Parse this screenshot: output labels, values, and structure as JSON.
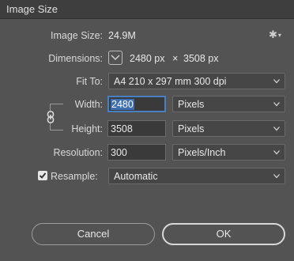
{
  "window": {
    "title": "Image Size"
  },
  "image_size": {
    "label": "Image Size:",
    "value": "24.9M"
  },
  "dimensions": {
    "label": "Dimensions:",
    "width": "2480 px",
    "times": "×",
    "height": "3508 px"
  },
  "fit_to": {
    "label": "Fit To:",
    "selected": "A4 210 x 297 mm 300 dpi"
  },
  "width": {
    "label": "Width:",
    "value": "2480",
    "unit": "Pixels"
  },
  "height": {
    "label": "Height:",
    "value": "3508",
    "unit": "Pixels"
  },
  "resolution": {
    "label": "Resolution:",
    "value": "300",
    "unit": "Pixels/Inch"
  },
  "resample": {
    "label": "Resample:",
    "checked": true,
    "method": "Automatic"
  },
  "buttons": {
    "cancel": "Cancel",
    "ok": "OK"
  },
  "icons": {
    "settings": "gear-icon",
    "dropdown": "chevron-down-icon",
    "constrain": "chain-link-icon"
  }
}
